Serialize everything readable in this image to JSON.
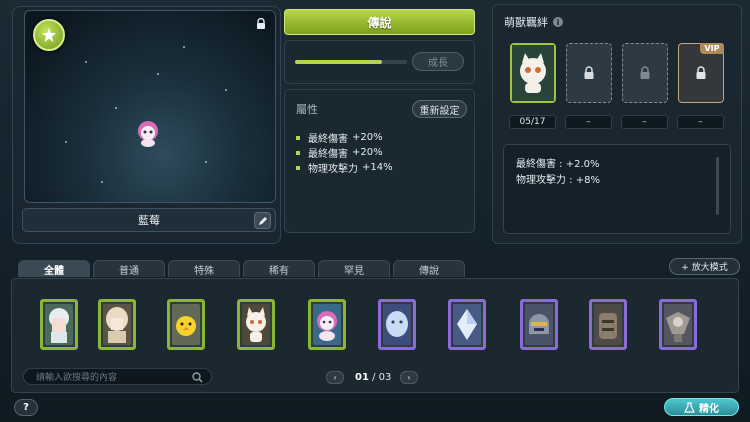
{
  "preview": {
    "pet_name": "藍莓",
    "grade_icon": "star-icon",
    "lock_icon": "lock-icon",
    "edit_icon": "pencil-icon"
  },
  "grade": {
    "label": "傳說",
    "color": "#b6d54b"
  },
  "growth": {
    "button_label": "成長",
    "progress": 0.78
  },
  "attributes": {
    "title": "屬性",
    "reset_label": "重新設定",
    "items": [
      {
        "name": "最終傷害",
        "value": "+20%"
      },
      {
        "name": "最終傷害",
        "value": "+20%"
      },
      {
        "name": "物理攻擊力",
        "value": "+14%"
      }
    ]
  },
  "bond": {
    "title": "萌獸羈絆",
    "info_icon": "i",
    "vip_label": "VIP",
    "slots": [
      {
        "label": "05/17",
        "state": "filled"
      },
      {
        "label": "–",
        "state": "locked"
      },
      {
        "label": "–",
        "state": "locked"
      },
      {
        "label": "–",
        "state": "vip-locked"
      }
    ],
    "effects": [
      {
        "name": "最終傷害",
        "value": "+2.0%"
      },
      {
        "name": "物理攻擊力",
        "value": "+8%"
      }
    ]
  },
  "tabs": [
    "全體",
    "普通",
    "特殊",
    "稀有",
    "罕見",
    "傳說"
  ],
  "active_tab": "全體",
  "zoom_label": "+ 放大模式",
  "cards": [
    {
      "frame": "green",
      "art": "white-hair-character"
    },
    {
      "frame": "green",
      "art": "blonde-character"
    },
    {
      "frame": "green",
      "art": "yellow-chick"
    },
    {
      "frame": "green",
      "art": "white-cat"
    },
    {
      "frame": "green",
      "art": "pink-spiky-creature"
    },
    {
      "frame": "purple",
      "art": "ice-spirit"
    },
    {
      "frame": "purple",
      "art": "ice-crystal"
    },
    {
      "frame": "purple",
      "art": "knight-helmet"
    },
    {
      "frame": "purple",
      "art": "stone-golem"
    },
    {
      "frame": "purple",
      "art": "winged-beast"
    }
  ],
  "search": {
    "placeholder": "請輸入欲搜尋的內容"
  },
  "pager": {
    "current": "01",
    "separator": "/",
    "total": "03"
  },
  "help_label": "?",
  "refine_label": "精化"
}
